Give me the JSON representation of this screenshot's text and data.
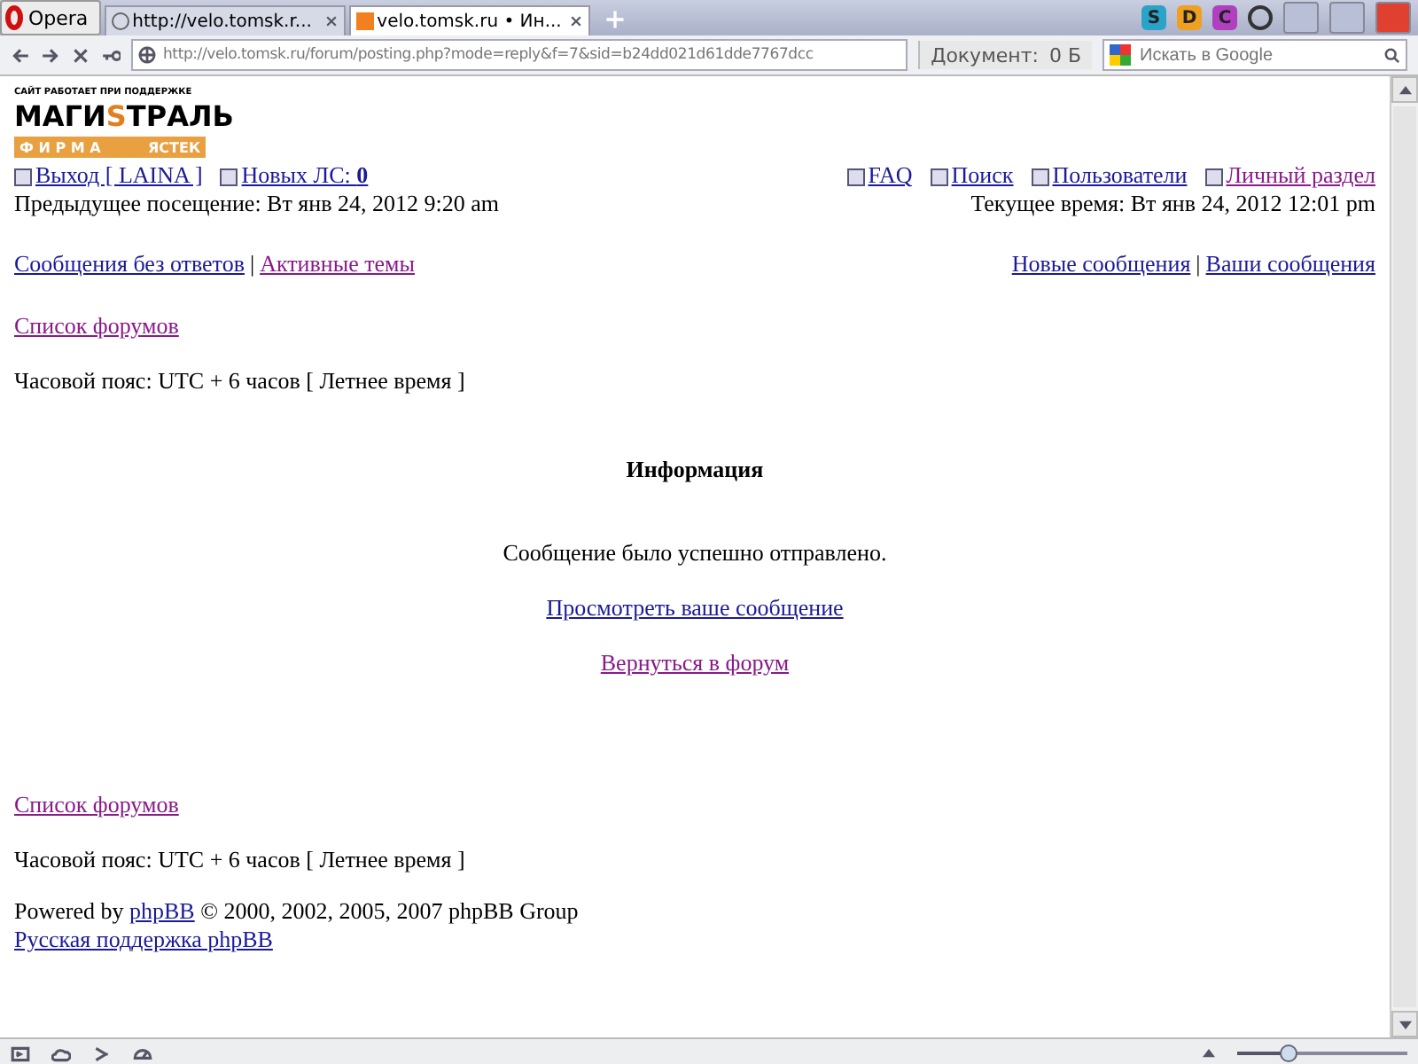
{
  "browser": {
    "menu_label": "Opera",
    "tabs": [
      {
        "title": "http://velo.tomsk.r...",
        "selected": false,
        "loading": true
      },
      {
        "title": "velo.tomsk.ru • Ин...",
        "selected": true,
        "loading": false
      }
    ],
    "address": "http://velo.tomsk.ru/forum/posting.php?mode=reply&f=7&sid=b24dd021d61dde7767dcc",
    "doc_label": "Документ:",
    "doc_size": "0 Б",
    "search_placeholder": "Искать в Google",
    "extensions": [
      {
        "letter": "S",
        "color": "#2aa3c8"
      },
      {
        "letter": "D",
        "color": "#f0a020"
      },
      {
        "letter": "C",
        "color": "#b040c0"
      }
    ]
  },
  "logo": {
    "tagline": "САЙТ РАБОТАЕТ ПРИ ПОДДЕРЖКЕ",
    "name_left": "МАГИ",
    "name_mid": "S",
    "name_right": "ТРАЛЬ",
    "firm": "Ф И Р М А",
    "firm_name": "ЯСТЕК"
  },
  "nav_left": [
    {
      "label": "Выход [ LAINA ]",
      "visited": false
    },
    {
      "label": "Новых ЛС: **0**",
      "visited": false
    }
  ],
  "nav_right": [
    {
      "label": "FAQ",
      "visited": false
    },
    {
      "label": "Поиск",
      "visited": false
    },
    {
      "label": "Пользователи",
      "visited": false
    },
    {
      "label": "Личный раздел",
      "visited": true
    }
  ],
  "last_visit": "Предыдущее посещение: Вт янв 24, 2012 9:20 am",
  "current_time": "Текущее время: Вт янв 24, 2012 12:01 pm",
  "links_left": [
    {
      "label": "Сообщения без ответов",
      "visited": false
    },
    {
      "label": "Активные темы",
      "visited": true
    }
  ],
  "links_right": [
    {
      "label": "Новые сообщения",
      "visited": false
    },
    {
      "label": "Ваши сообщения",
      "visited": false
    }
  ],
  "separator": "|",
  "forum_index": {
    "label": "Список форумов",
    "visited": true
  },
  "timezone": "Часовой пояс: UTC + 6 часов [ Летнее время ]",
  "info": {
    "title": "Информация",
    "message": "Сообщение было успешно отправлено.",
    "links": [
      {
        "label": "Просмотреть ваше сообщение",
        "visited": false
      },
      {
        "label": "Вернуться в форум",
        "visited": true
      }
    ]
  },
  "footer_forum_index": {
    "label": "Список форумов",
    "visited": true
  },
  "footer_timezone": "Часовой пояс: UTC + 6 часов [ Летнее время ]",
  "powered": {
    "before": "Powered by",
    "link": {
      "label": "phpBB",
      "visited": false
    },
    "after": "© 2000, 2002, 2005, 2007 phpBB Group"
  },
  "support_link": {
    "label": "Русская поддержка phpBB",
    "visited": false
  },
  "zoom": {
    "level": 0.3
  }
}
